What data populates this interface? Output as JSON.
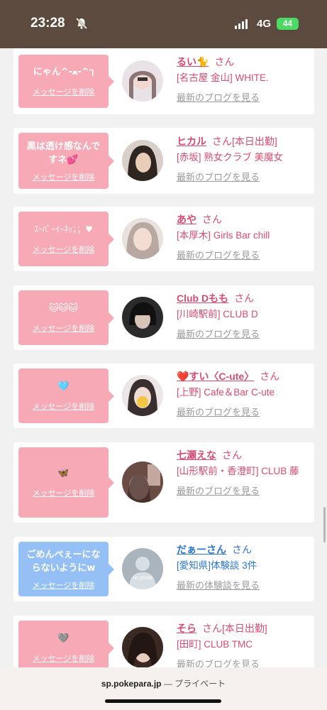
{
  "status_bar": {
    "time": "23:28",
    "network": "4G",
    "battery": "44"
  },
  "cards": [
    {
      "message": "にゃん^-ﻌ-^ๅ",
      "delete_label": "メッセージを削除",
      "name": "るい🐈",
      "honorific": "さん",
      "tag": "",
      "shop": "[名古屋 金山] WHITE.",
      "link": "最新のブログを見る",
      "color": "pink"
    },
    {
      "message": "黒は透け感なんですネ💕",
      "delete_label": "メッセージを削除",
      "name": "ヒカル",
      "honorific": "さん",
      "tag": "[本日出勤]",
      "shop": "[赤坂] 熟女クラブ 美魔女",
      "link": "最新のブログを見る",
      "color": "pink"
    },
    {
      "message": "ｽｰﾊﾟｰｲｰﾈｯ；；♥",
      "delete_label": "メッセージを削除",
      "name": "あや",
      "honorific": "さん",
      "tag": "",
      "shop": "[本厚木] Girls Bar chill",
      "link": "最新のブログを見る",
      "color": "pink"
    },
    {
      "message": "🐱🐱🐱",
      "delete_label": "メッセージを削除",
      "name": "Club Dもも",
      "honorific": "さん",
      "tag": "",
      "shop": "[川崎駅前] CLUB D",
      "link": "最新のブログを見る",
      "color": "pink"
    },
    {
      "message": "🩵",
      "delete_label": "メッセージを削除",
      "name": "❤️すい〈C-ute〉",
      "honorific": "さん",
      "tag": "",
      "shop": "[上野] Cafe＆Bar C-ute",
      "link": "最新のブログを見る",
      "color": "pink"
    },
    {
      "message": "🦋",
      "delete_label": "メッセージを削除",
      "name": "七瀬えな",
      "honorific": "さん",
      "tag": "",
      "shop": "[山形駅前・香澄町] CLUB 藤",
      "link": "最新のブログを見る",
      "color": "pink"
    },
    {
      "message": "ごめんぺぇーにならないようにw",
      "delete_label": "メッセージを削除",
      "name": "だぁーさん",
      "honorific": "さん",
      "tag": "",
      "shop": "[愛知県]体験談 3件",
      "link": "最新の体験談を見る",
      "color": "blue"
    },
    {
      "message": "🩶",
      "delete_label": "メッセージを削除",
      "name": "そら",
      "honorific": "さん",
      "tag": "[本日出勤]",
      "shop": "[田町] CLUB TMC",
      "link": "最新のブログを見る",
      "color": "pink"
    }
  ],
  "no_photo_label": "no photo",
  "browser": {
    "host": "sp.pokepara.jp",
    "separator": " — ",
    "mode": "プライベート"
  }
}
